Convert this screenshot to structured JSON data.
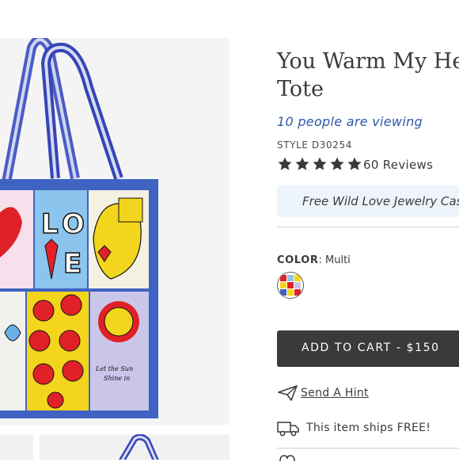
{
  "product": {
    "title_line1": "You Warm My Hea",
    "title_line2": "Tote",
    "viewing": "10 people are viewing",
    "style": "STYLE D30254",
    "rating": 5,
    "rating_max": 5,
    "reviews": "60 Reviews",
    "promo": "Free Wild Love Jewelry Cas",
    "color_label": "COLOR",
    "color_value": ": Multi",
    "add_to_cart": "ADD TO CART - $150",
    "send_hint": "Send A Hint",
    "ships_free": "This item ships FREE!"
  },
  "artwork": {
    "love_letters": [
      "L",
      "O",
      "V",
      "E"
    ],
    "poem_line1": "Let the Sun",
    "poem_line2": "Shine in",
    "poem_line3": "Shine in"
  },
  "colors": {
    "accent_blue": "#2f57a6",
    "button_dark": "#3a3a3a",
    "promo_bg": "#eef4fb",
    "tote_blue": "#3e63c2",
    "star": "#3a3a3a"
  },
  "icons": {
    "star": "star-icon",
    "hint": "paper-plane-icon",
    "ship": "truck-icon"
  }
}
